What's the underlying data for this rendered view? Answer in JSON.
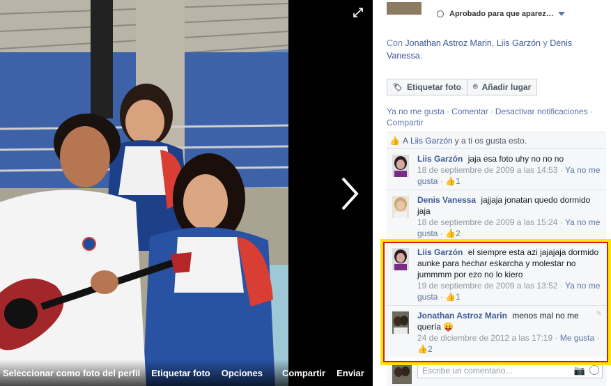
{
  "viewer": {
    "actions": [
      "Seleccionar como foto del perfil",
      "Etiquetar foto",
      "Opciones",
      "Compartir",
      "Enviar"
    ],
    "icons": {
      "expand": "expand-icon",
      "next": "chevron-right-icon"
    }
  },
  "sidebar": {
    "privacy_status": "Aprobado para que aparez…",
    "with_prefix": "Con",
    "with_names": [
      "Jonathan Astroz Marin",
      "Liis Garzón",
      "Denis Vanessa"
    ],
    "with_sep": ",",
    "with_and": "y",
    "buttons": {
      "tag_photo": "Etiquetar foto",
      "add_place": "Añadir lugar"
    },
    "actions": {
      "unlike": "Ya no me gusta",
      "comment": "Comentar",
      "notifications": "Desactivar notificaciones",
      "share": "Compartir"
    },
    "likes": {
      "prefix": "A",
      "name": "Liis Garzón",
      "suffix": "y a ti os gusta esto."
    },
    "comments": [
      {
        "author": "Liis Garzón",
        "text": "jaja esa foto uhy no no no",
        "date": "18 de septiembre de 2009 a las 14:53",
        "action": "Ya no me gusta",
        "likes": "1"
      },
      {
        "author": "Denis Vanessa",
        "text": "jajjaja jonatan quedo dormido jaja",
        "date": "18 de septiembre de 2009 a las 15:24",
        "action": "Ya no me gusta",
        "likes": "2"
      },
      {
        "author": "Liis Garzón",
        "text": "el siempre esta azi jajajaja dormido aunke para hechar eskarcha y molestar no jummmm por ezo no lo kiero",
        "date": "19 de septiembre de 2009 a las 13:52",
        "action": "Ya no me gusta",
        "likes": "1"
      },
      {
        "author": "Jonathan Astroz Marin",
        "text": "menos mal no me quería 😛",
        "date": "24 de diciembre de 2012 a las 17:19",
        "action": "Me gusta",
        "likes": "2"
      }
    ],
    "write_placeholder": "Escribe un comentario...",
    "colors": {
      "link": "#3b5998",
      "highlight_outer": "#ffe600",
      "highlight_inner": "#e3131b"
    }
  }
}
